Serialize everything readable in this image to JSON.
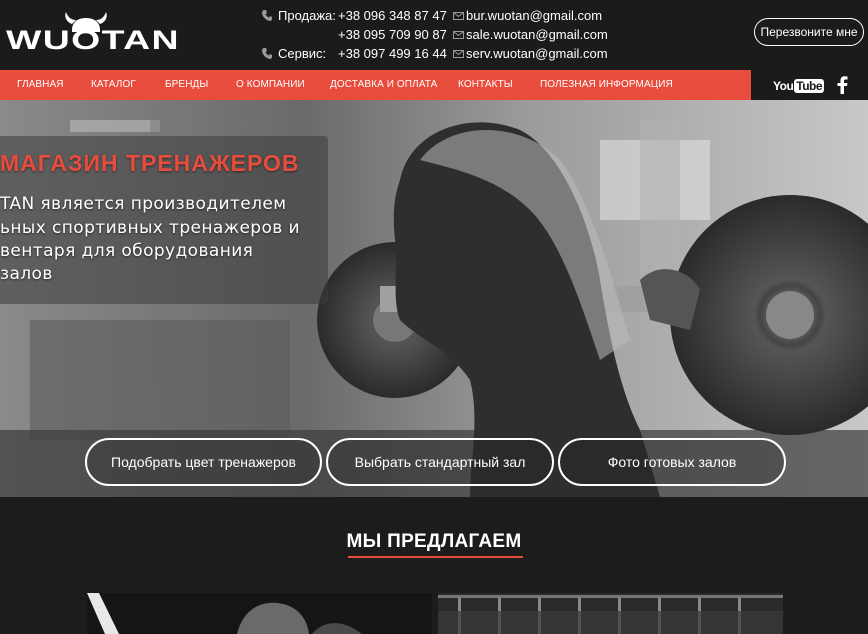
{
  "header": {
    "brand": "WUOTAN",
    "sales_label": "Продажа:",
    "sales_phone_1": "+38 096 348 87 47",
    "sales_phone_2": "+38 095 709 90 87",
    "service_label": "Сервис:",
    "service_phone": "+38 097 499 16 44",
    "emails": [
      "bur.wuotan@gmail.com",
      "sale.wuotan@gmail.com",
      "serv.wuotan@gmail.com"
    ],
    "callback_label": "Перезвоните мне"
  },
  "nav": {
    "items": [
      "ГЛАВНАЯ",
      "КАТАЛОГ",
      "БРЕНДЫ",
      "О КОМПАНИИ",
      "ДОСТАВКА И ОПЛАТА",
      "КОНТАКТЫ",
      "ПОЛЕЗНАЯ ИНФОРМАЦИЯ"
    ],
    "youtube_you": "You",
    "youtube_tube": "Tube"
  },
  "hero": {
    "title": "МАГАЗИН ТРЕНАЖЕРОВ",
    "lines": [
      "TAN является производителем",
      "ьных спортивных тренажеров и",
      "вентаря для оборудования",
      "залов"
    ],
    "buttons": [
      "Подобрать цвет тренажеров",
      "Выбрать стандартный зал",
      "Фото готовых залов"
    ]
  },
  "offer": {
    "title": "МЫ ПРЕДЛАГАЕМ"
  },
  "colors": {
    "accent": "#e84c3d",
    "dark": "#1b1b1b",
    "text": "#ffffff"
  },
  "icons": [
    "phone-icon",
    "mail-icon",
    "youtube-icon",
    "facebook-icon",
    "viking-helmet-icon"
  ]
}
